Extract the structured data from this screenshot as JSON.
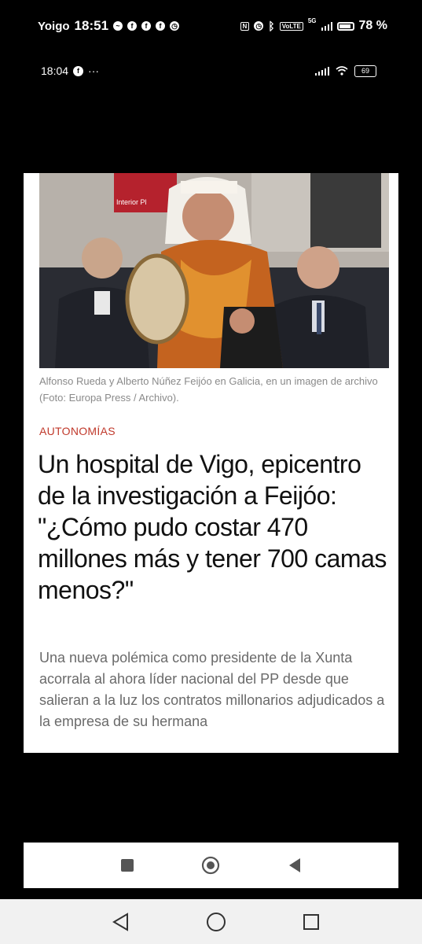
{
  "status_bar": {
    "carrier": "Yoigo",
    "time": "18:51",
    "battery": "78 %",
    "battery_level": 0.78,
    "volte": "VoLTE",
    "network": "5G",
    "icons": [
      "messenger-icon",
      "facebook-icon",
      "facebook-icon",
      "facebook-icon",
      "alarm-icon",
      "nfc-icon",
      "alarm-icon",
      "bluetooth-icon",
      "volte-icon",
      "signal-icon",
      "battery-icon"
    ]
  },
  "inner_status": {
    "time": "18:04",
    "dots": "···",
    "battery": "69",
    "icons": [
      "facebook-icon",
      "signal-icon",
      "wifi-icon",
      "battery-icon"
    ]
  },
  "article": {
    "caption": "Alfonso Rueda y Alberto Núñez Feijóo en Galicia, en un imagen de archivo (Foto: Europa Press / Archivo).",
    "section": "AUTONOMÍAS",
    "headline": "Un hospital de Vigo, epicentro de la investigación a Feijóo: \"¿Cómo pudo costar 470 millones más y tener 700 camas menos?\"",
    "subhead": "Una nueva polémica como presidente de la Xunta acorrala al ahora líder nacional del PP desde que salieran a la luz los contratos millonarios adjudicados a la empresa de su hermana",
    "photo_sign_text": "Interior Pl"
  },
  "inner_nav": {
    "icons": [
      "recents-square-icon",
      "home-circle-icon",
      "back-triangle-icon"
    ]
  },
  "system_nav": {
    "icons": [
      "back-triangle-icon",
      "home-circle-icon",
      "recents-square-icon"
    ]
  }
}
